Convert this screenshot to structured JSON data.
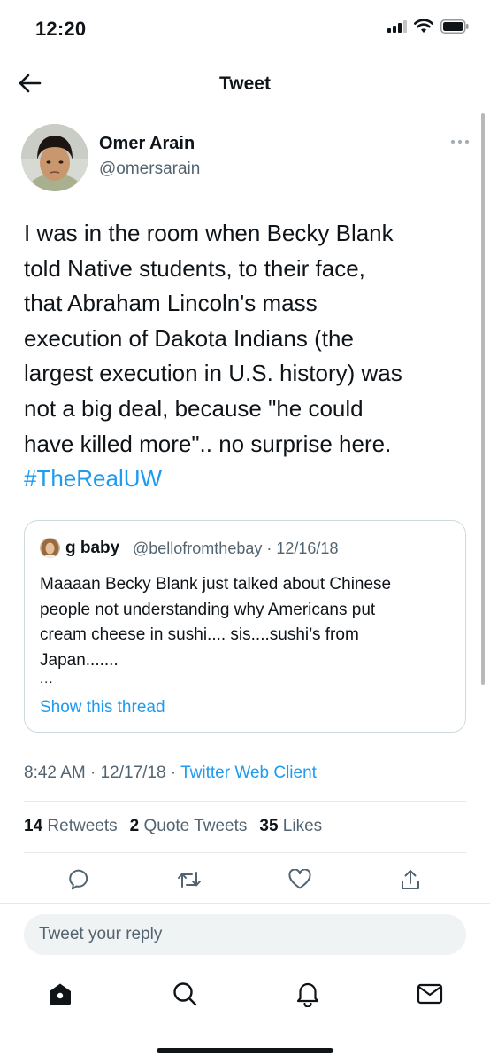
{
  "status_bar": {
    "time": "12:20",
    "icons": [
      "signal-icon",
      "wifi-icon",
      "battery-icon"
    ]
  },
  "header": {
    "title": "Tweet",
    "back_icon": "arrow-left-icon"
  },
  "tweet": {
    "author_name": "Omer Arain",
    "author_handle": "@omersarain",
    "text_lines": [
      "I was in the room when Becky Blank",
      "told Native students, to their face,",
      "that Abraham Lincoln's mass",
      "execution of Dakota Indians (the",
      "largest execution in U.S. history) was",
      "not a big deal, because \"he could",
      "have killed more\".. no surprise here."
    ],
    "hashtag": "#TheRealUW",
    "time": "8:42 AM",
    "date": "12/17/18",
    "separator": "·",
    "client": "Twitter Web Client"
  },
  "quote": {
    "author_name": "g baby",
    "author_handle": "@bellofromthebay",
    "separator": "·",
    "date": "12/16/18",
    "text_lines": [
      "Maaaan Becky Blank just talked about Chinese",
      "people not understanding why Americans put",
      "cream cheese in sushi.... sis....sushi’s from",
      "Japan......."
    ],
    "ellipsis": "...",
    "show_thread": "Show this thread"
  },
  "stats": {
    "retweets_count": "14",
    "retweets_label": "Retweets",
    "quotes_count": "2",
    "quotes_label": "Quote Tweets",
    "likes_count": "35",
    "likes_label": "Likes"
  },
  "actions": [
    "reply-icon",
    "retweet-icon",
    "like-icon",
    "share-icon"
  ],
  "reply_box": {
    "placeholder": "Tweet your reply"
  },
  "bottom_nav": [
    "home-icon",
    "search-icon",
    "notifications-icon",
    "messages-icon"
  ],
  "colors": {
    "accent": "#1d9bf0",
    "text": "#0f1419",
    "secondary": "#536471",
    "border": "#cfd9de"
  }
}
